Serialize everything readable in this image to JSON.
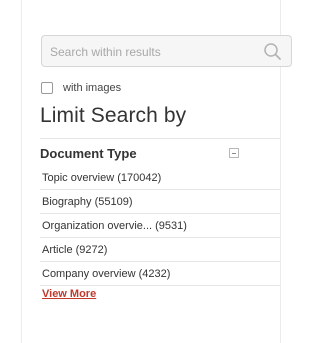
{
  "search": {
    "placeholder": "Search within results",
    "value": ""
  },
  "filters": {
    "with_images_label": "with images",
    "with_images_checked": false
  },
  "limit_search": {
    "title": "Limit Search by",
    "document_type": {
      "label": "Document Type",
      "items": [
        {
          "label": "Topic overview (170042)"
        },
        {
          "label": "Biography (55109)"
        },
        {
          "label": "Organization overvie... (9531)"
        },
        {
          "label": "Article (9272)"
        },
        {
          "label": "Company overview (4232)"
        }
      ],
      "view_more_label": "View More"
    }
  },
  "colors": {
    "link": "#c0392b",
    "border": "#e6e6e6",
    "text": "#333333"
  }
}
